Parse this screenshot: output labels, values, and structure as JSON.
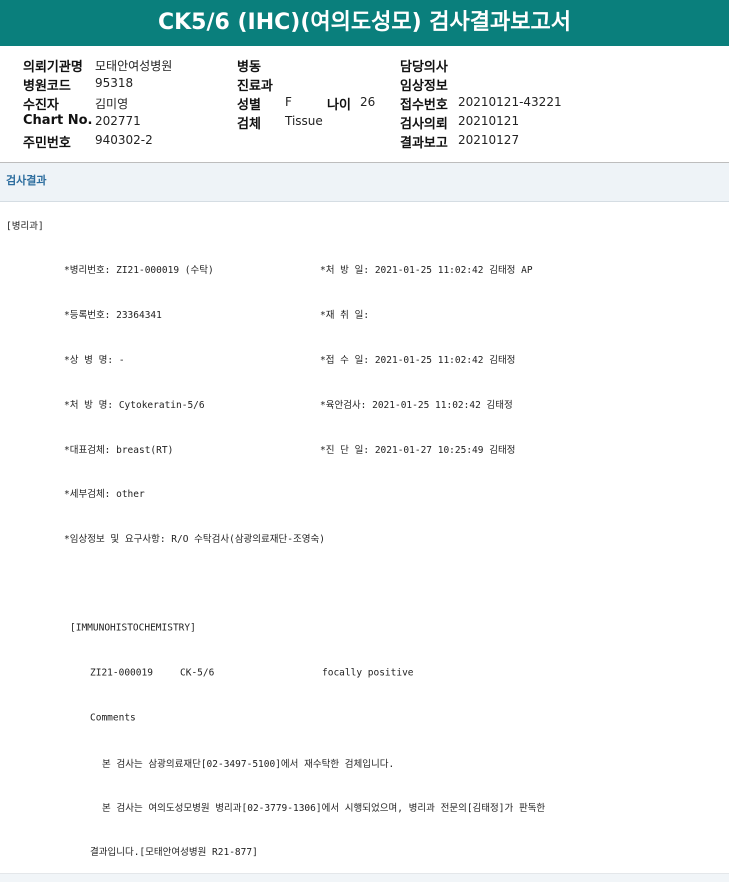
{
  "title": "CK5/6 (IHC)(여의도성모) 검사결과보고서",
  "patient": {
    "institution_label": "의뢰기관명",
    "institution": "모태안여성병원",
    "hospital_code_label": "병원코드",
    "hospital_code": "95318",
    "patient_label": "수진자",
    "patient": "김미영",
    "chart_label": "Chart No.",
    "chart": "202771",
    "rrn_label": "주민번호",
    "rrn": "940302-2",
    "ward_label": "병동",
    "ward": "",
    "dept_label": "진료과",
    "dept": "",
    "sex_label": "성별",
    "sex": "F",
    "age_label": "나이",
    "age": "26",
    "specimen_label": "검체",
    "specimen": "Tissue",
    "doctor_label": "담당의사",
    "doctor": "",
    "clinical_label": "임상정보",
    "clinical": "",
    "accession_label": "접수번호",
    "accession": "20210121-43221",
    "request_label": "검사의뢰",
    "request": "20210121",
    "report_label": "결과보고",
    "report": "20210127"
  },
  "results": {
    "section_title": "검사결과",
    "dept_line": "[병리과]",
    "rows": [
      {
        "left": "*병리번호: ZI21-000019 (수탁)",
        "right": "*처 방 일: 2021-01-25 11:02:42  김태정 AP"
      },
      {
        "left": "*등록번호: 23364341",
        "right": "*재 취 일:"
      },
      {
        "left": "*상 병 명: -",
        "right": "*접 수 일: 2021-01-25 11:02:42  김태정"
      },
      {
        "left": "*처 방 명: Cytokeratin-5/6",
        "right": "*육안검사: 2021-01-25 11:02:42  김태정"
      },
      {
        "left": "*대표검체: breast(RT)",
        "right": "*진 단 일: 2021-01-27 10:25:49  김태정"
      },
      {
        "left": "*세부검체: other",
        "right": ""
      },
      {
        "left": "*임상정보 및 요구사항: R/O 수탁검사(삼광의료재단-조영숙)",
        "right": ""
      }
    ],
    "ihc_header": "[IMMUNOHISTOCHEMISTRY]",
    "ihc_no": "ZI21-000019",
    "ihc_marker": "CK-5/6",
    "ihc_result": "focally positive",
    "comments_label": "Comments",
    "comment1": "본 검사는 삼광의료재단[02-3497-5100]에서 재수탁한 검체입니다.",
    "comment2": "본 검사는 여의도성모병원 병리과[02-3779-1306]에서 시행되었으며, 병리과 전문의[김태정]가 판독한",
    "comment3": "결과입니다.[모태안여성병원 R21-877]"
  }
}
